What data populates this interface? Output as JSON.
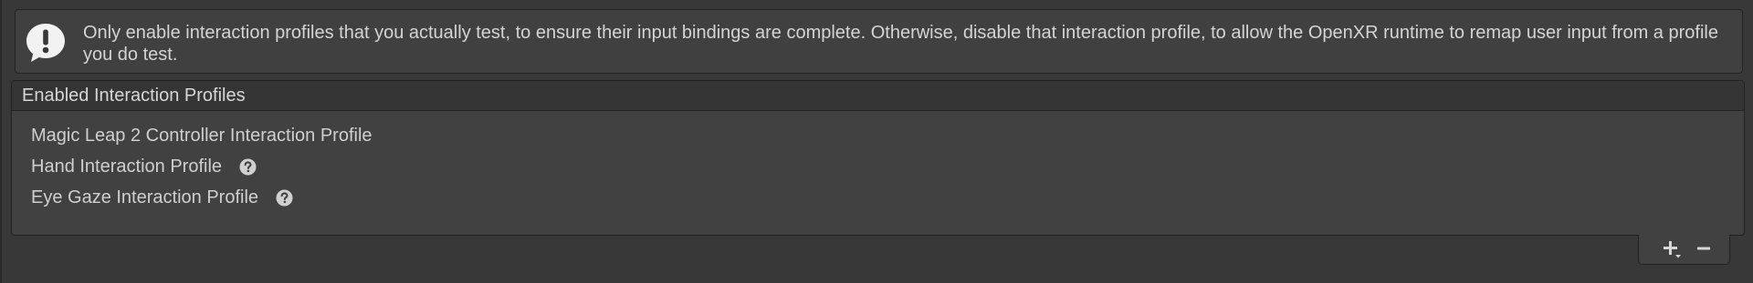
{
  "help_box": {
    "icon": "exclamation-speech-bubble-icon",
    "message": "Only enable interaction profiles that you actually test, to ensure their input bindings are complete. Otherwise, disable that interaction profile, to allow the OpenXR runtime to remap user input from a profile you do test."
  },
  "profiles_list": {
    "header": "Enabled Interaction Profiles",
    "items": [
      {
        "label": "Magic Leap 2 Controller Interaction Profile",
        "has_help": false
      },
      {
        "label": "Hand Interaction Profile",
        "has_help": true,
        "help_icon": "question-circle-icon"
      },
      {
        "label": "Eye Gaze Interaction Profile",
        "has_help": true,
        "help_icon": "question-circle-icon"
      }
    ],
    "footer": {
      "add_icon": "plus-dropdown-icon",
      "remove_icon": "minus-icon"
    }
  },
  "colors": {
    "background": "#383838",
    "panel": "#414141",
    "header": "#353535",
    "border": "#212121",
    "text": "#d2d2d2"
  }
}
